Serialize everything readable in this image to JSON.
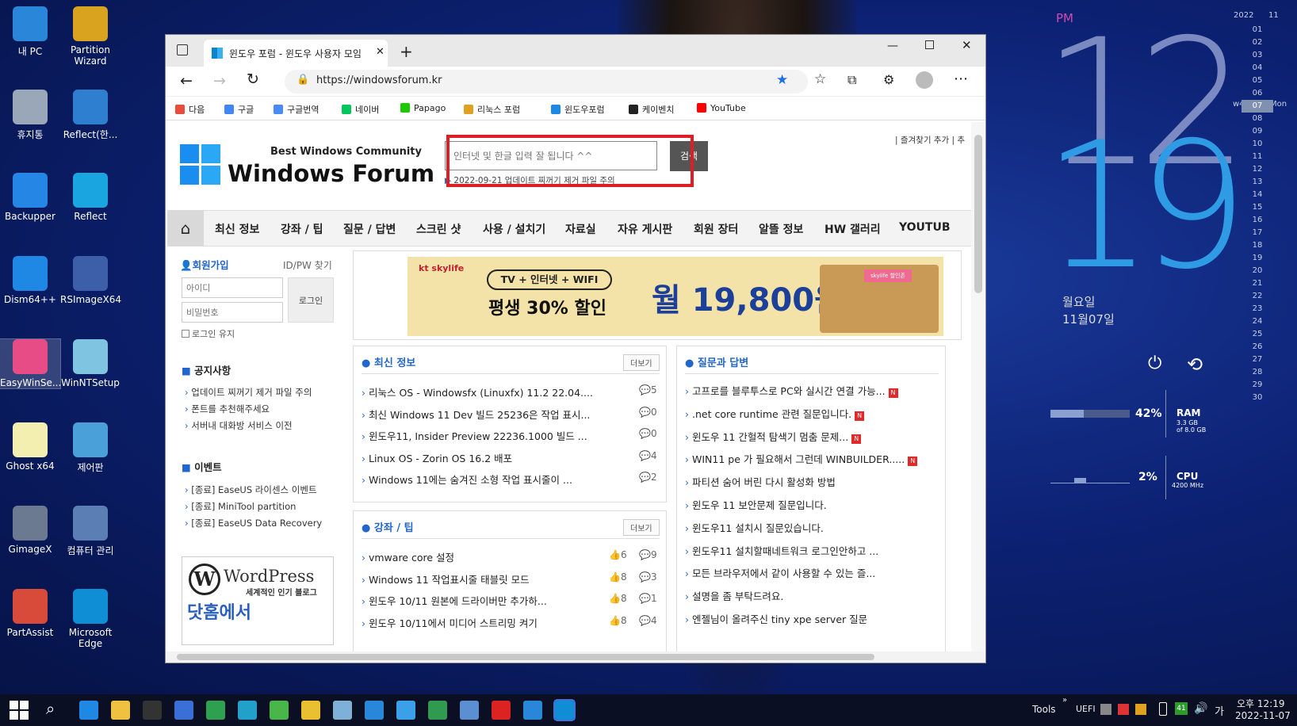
{
  "desktop": {
    "icons": [
      {
        "label": "내 PC",
        "color": "#2a86d8"
      },
      {
        "label": "Partition Wizard",
        "color": "#d9a21f"
      },
      {
        "label": "휴지통",
        "color": "#9aa7b8"
      },
      {
        "label": "Reflect(한...",
        "color": "#2f7fd0"
      },
      {
        "label": "Backupper",
        "color": "#2586e6"
      },
      {
        "label": "Reflect",
        "color": "#1aa5e0"
      },
      {
        "label": "Dism64++",
        "color": "#1f88e5"
      },
      {
        "label": "RSImageX64",
        "color": "#3d5ea8"
      },
      {
        "label": "EasyWinSe...",
        "color": "#e84c86"
      },
      {
        "label": "WinNTSetup",
        "color": "#7fc4e0"
      },
      {
        "label": "Ghost x64",
        "color": "#f2efb0"
      },
      {
        "label": "제어판",
        "color": "#4aa0d8"
      },
      {
        "label": "GimageX",
        "color": "#6b7a90"
      },
      {
        "label": "컴퓨터 관리",
        "color": "#5b7fb5"
      },
      {
        "label": "PartAssist",
        "color": "#d84a3a"
      },
      {
        "label": "Microsoft Edge",
        "color": "#0f8ed6"
      }
    ]
  },
  "clock": {
    "ampm": "PM",
    "hour": "12",
    "minute": "19",
    "weekday": "월요일",
    "date": "11월07일",
    "year": "2022",
    "month": "11",
    "week": "w46",
    "day_label": "Mon",
    "days": [
      "01",
      "02",
      "03",
      "04",
      "05",
      "06",
      "07",
      "08",
      "09",
      "10",
      "11",
      "12",
      "13",
      "14",
      "15",
      "16",
      "17",
      "18",
      "19",
      "20",
      "21",
      "22",
      "23",
      "24",
      "25",
      "26",
      "27",
      "28",
      "29",
      "30"
    ],
    "ram": {
      "percent": "42%",
      "label": "RAM",
      "detail": "3.3 GB",
      "detail2": "of 8.0 GB",
      "level": 42
    },
    "cpu": {
      "percent": "2%",
      "label": "CPU",
      "detail": "4200 MHz",
      "level": 2
    }
  },
  "browser": {
    "tab_title": "윈도우 포럼 - 윈도우 사용자 모임",
    "url": "https://windowsforum.kr",
    "bookmarks": [
      {
        "label": "다음",
        "color": "#e84c3d"
      },
      {
        "label": "구글",
        "color": "#4285f4"
      },
      {
        "label": "구글번역",
        "color": "#4a8af4"
      },
      {
        "label": "네이버",
        "color": "#03c75a"
      },
      {
        "label": "Papago",
        "color": "#1ec800"
      },
      {
        "label": "리눅스 포럼",
        "color": "#e0a020"
      },
      {
        "label": "윈도우포럼",
        "color": "#1e88e5"
      },
      {
        "label": "케이벤치",
        "color": "#222222"
      },
      {
        "label": "YouTube",
        "color": "#ff0000"
      }
    ]
  },
  "site": {
    "tagline": "Best Windows Community",
    "brand": "Windows Forum",
    "search_placeholder": "인터넷 및 한글 입력 잘 됩니다 ^^",
    "search_button": "검색",
    "notice_ticker": "2022-09-21 업데이트 찌꺼기 제거 파일 주의",
    "top_links": "| 즐겨찾기 추가 | 추",
    "nav": [
      "최신 정보",
      "강좌 / 팁",
      "질문 / 답변",
      "스크린 샷",
      "사용 / 설치기",
      "자료실",
      "자유 게시판",
      "회원 장터",
      "알뜰 정보",
      "HW 갤러리",
      "YOUTUB"
    ],
    "login": {
      "signup": "회원가입",
      "find": "ID/PW 찾기",
      "id_placeholder": "아이디",
      "pw_placeholder": "비밀번호",
      "button": "로그인",
      "keep": "로그인 유지"
    },
    "notices_title": "공지사항",
    "notices": [
      "업데이트 찌꺼기 제거 파일 주의",
      "폰트를 추천해주세요",
      "서버내 대화방 서비스 이전"
    ],
    "events_title": "이벤트",
    "events": [
      "[종료] EaseUS 라이센스 이벤트",
      "[종료] MiniTool partition",
      "[종료] EaseUS Data Recovery"
    ],
    "wordpress": {
      "title": "WordPress",
      "sub": "세계적인 인기 블로그",
      "cta": "닷홈에서"
    },
    "ad": {
      "brand": "kt skylife",
      "line1": "TV + 인터넷 + WIFI",
      "line2": "평생 30% 할인",
      "price": "월 19,800원",
      "tag": "skylife 할인존"
    },
    "latest": {
      "title": "최신 정보",
      "more": "더보기",
      "items": [
        {
          "t": "리눅스 OS - Windowsfx (Linuxfx) 11.2 22.04....",
          "c": "5"
        },
        {
          "t": "최신 Windows 11 Dev 빌드 25236은 작업 표시...",
          "c": "0"
        },
        {
          "t": "윈도우11, Insider Preview 22236.1000 빌드 ...",
          "c": "0"
        },
        {
          "t": "Linux OS - Zorin OS 16.2 배포",
          "c": "4"
        },
        {
          "t": "Windows 11에는 숨겨진 소형 작업 표시줄이 ...",
          "c": "2"
        }
      ]
    },
    "tips": {
      "title": "강좌 / 팁",
      "more": "더보기",
      "items": [
        {
          "t": "vmware core 설정",
          "l": "6",
          "c": "9"
        },
        {
          "t": "Windows 11 작업표시줄 태블릿 모드",
          "l": "8",
          "c": "3"
        },
        {
          "t": "윈도우 10/11 원본에 드라이버만 추가하...",
          "l": "8",
          "c": "1"
        },
        {
          "t": "윈도우 10/11에서 미디어 스트리밍 켜기",
          "l": "8",
          "c": "4"
        }
      ]
    },
    "qna": {
      "title": "질문과 답변",
      "items": [
        {
          "t": "고프로를 블루투스로 PC와 실시간 연결 가능...",
          "n": true
        },
        {
          "t": ".net core runtime 관련 질문입니다.",
          "n": true
        },
        {
          "t": "윈도우 11 간헐적 탐색기 멈춤 문제...",
          "n": true
        },
        {
          "t": "WIN11 pe 가 필요해서 그런데 WINBUILDER.....",
          "n": true
        },
        {
          "t": "파티션 숨어 버린 다시 활성화 방법",
          "n": false
        },
        {
          "t": "윈도우 11 보안문제 질문입니다.",
          "n": false
        },
        {
          "t": "윈도우11 설치시 질문있습니다.",
          "n": false
        },
        {
          "t": "윈도우11 설치할때네트워크 로그인안하고 ...",
          "n": false
        },
        {
          "t": "모든 브라우저에서 같이 사용할 수 있는 즐...",
          "n": false
        },
        {
          "t": "설명을 좀 부탁드려요.",
          "n": false
        },
        {
          "t": "엔젤님이 올려주신 tiny xpe server 질문",
          "n": false
        }
      ]
    }
  },
  "taskbar": {
    "tools": "Tools",
    "uefi": "UEFI",
    "time": "오후 12:19",
    "date": "2022-11-07",
    "lang": "가",
    "badge": "41",
    "apps": [
      "#1e88e5",
      "#f0c040",
      "#333333",
      "#3a6fd8",
      "#2ea04f",
      "#21a0c8",
      "#4ab54a",
      "#e8c030",
      "#7fb0d8",
      "#2a86d8",
      "#3aa0e8",
      "#2f9a50",
      "#5b8fd0",
      "#d22",
      "#2a86d8",
      "#0f8ed6"
    ]
  }
}
